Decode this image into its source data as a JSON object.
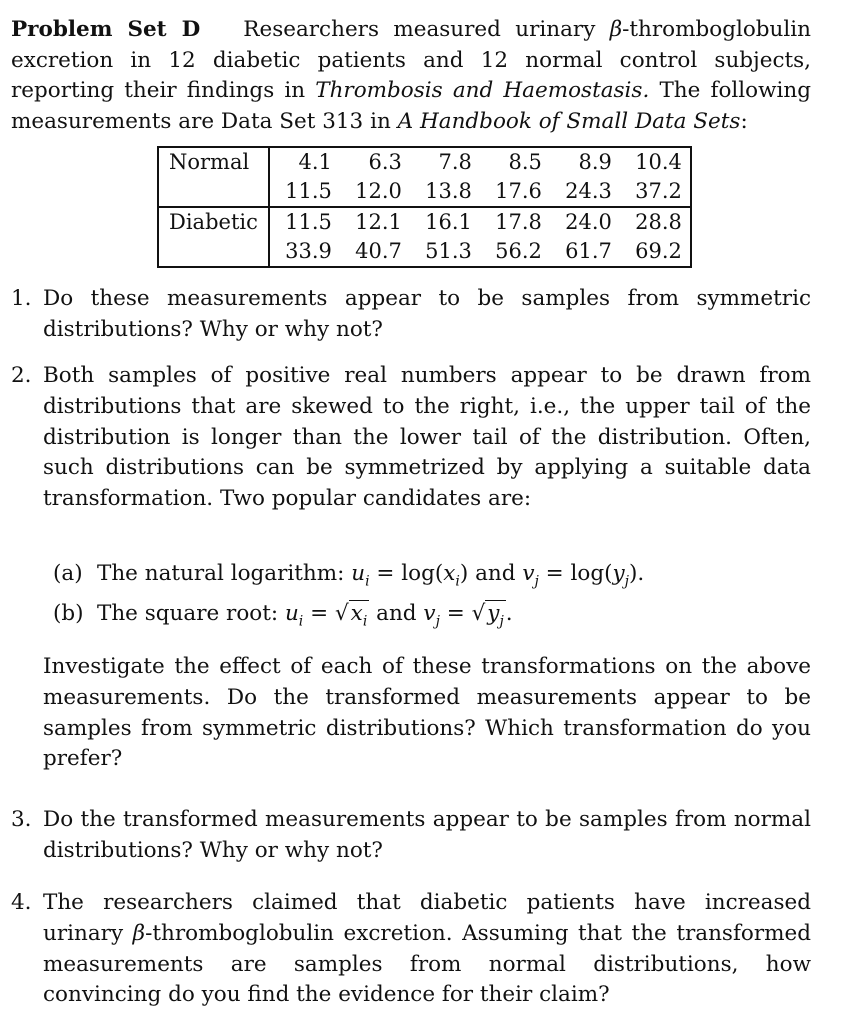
{
  "heading": "Problem Set D",
  "intro": {
    "part1": "Researchers measured urinary ",
    "beta": "β",
    "part2": "-thromboglobulin excretion in 12 diabetic patients and 12 normal control subjects, reporting their findings in ",
    "journal": "Thrombosis and Haemostasis.",
    "part3": " The following measurements are Data Set 313 in ",
    "book": "A Handbook of Small Data Sets",
    "part4": ":"
  },
  "table": {
    "groups": [
      {
        "label": "Normal",
        "rows": [
          [
            "4.1",
            "6.3",
            "7.8",
            "8.5",
            "8.9",
            "10.4"
          ],
          [
            "11.5",
            "12.0",
            "13.8",
            "17.6",
            "24.3",
            "37.2"
          ]
        ]
      },
      {
        "label": "Diabetic",
        "rows": [
          [
            "11.5",
            "12.1",
            "16.1",
            "17.8",
            "24.0",
            "28.8"
          ],
          [
            "33.9",
            "40.7",
            "51.3",
            "56.2",
            "61.7",
            "69.2"
          ]
        ]
      }
    ]
  },
  "questions": [
    {
      "num": "1.",
      "text": "Do these measurements appear to be samples from symmetric distributions? Why or why not?"
    },
    {
      "num": "2.",
      "text": "Both samples of positive real numbers appear to be drawn from distributions that are skewed to the right, i.e., the upper tail of the distribution is longer than the lower tail of the distribution. Often, such distributions can be symmetrized by applying a suitable data transformation. Two popular candidates are:",
      "subitems": [
        {
          "label": "(a)",
          "text": "The natural logarithm: ",
          "math1": "u",
          "math1_sub": "i",
          "eq1": " = log(",
          "x": "x",
          "x_sub": "i",
          "close1": ")",
          "and": " and ",
          "math2": "v",
          "math2_sub": "j",
          "eq2": " = log(",
          "y": "y",
          "y_sub": "j",
          "close2": ")."
        },
        {
          "label": "(b)",
          "text": "The square root: ",
          "math1": "u",
          "math1_sub": "i",
          "eq": " = ",
          "x": "x",
          "x_sub": "i",
          "and": " and ",
          "math2": "v",
          "math2_sub": "j",
          "y": "y",
          "y_sub": "j",
          "end": "."
        }
      ],
      "followup": "Investigate the effect of each of these transformations on the above measurements. Do the transformed measurements appear to be samples from symmetric distributions? Which transformation do you prefer?"
    },
    {
      "num": "3.",
      "text": "Do the transformed measurements appear to be samples from normal distributions? Why or why not?"
    },
    {
      "num": "4.",
      "text_pre": "The researchers claimed that diabetic patients have increased urinary ",
      "beta": "β",
      "text_post": "-thromboglobulin excretion. Assuming that the transformed measurements are samples from normal distributions, how convincing do you find the evidence for their claim?"
    }
  ]
}
